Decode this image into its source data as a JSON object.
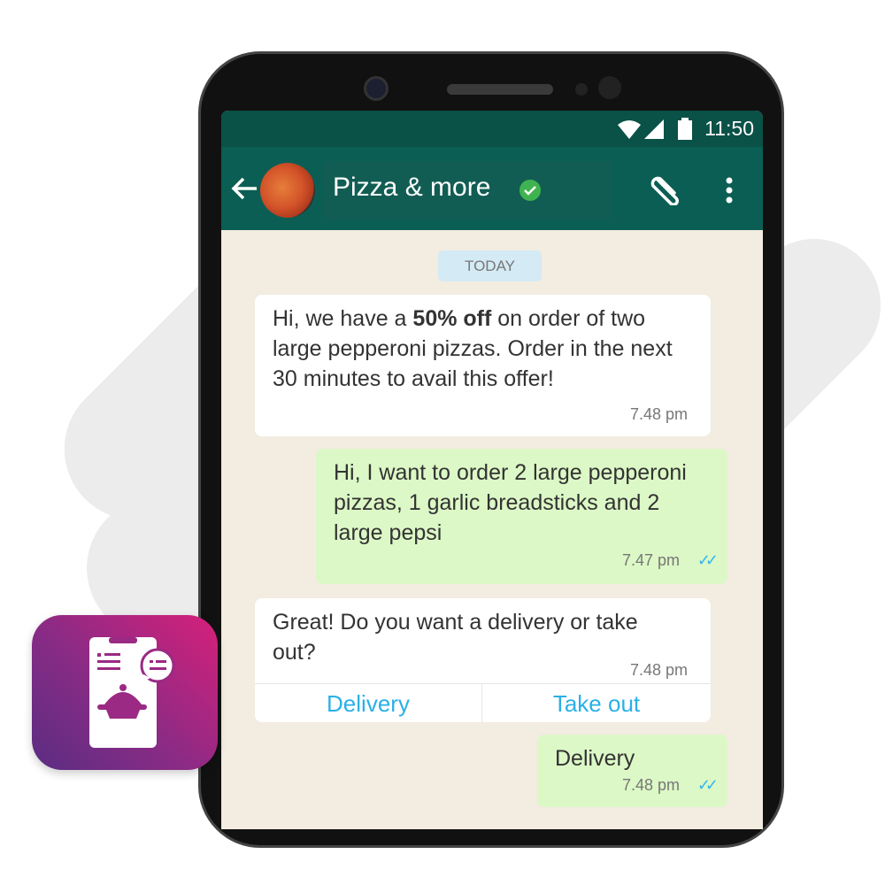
{
  "status_bar": {
    "time": "11:50"
  },
  "header": {
    "contact_name": "Pizza & more",
    "verified": true
  },
  "chat": {
    "date_label": "TODAY",
    "messages": [
      {
        "direction": "incoming",
        "text_before": "Hi, we have a ",
        "text_bold": "50% off",
        "text_after": " on order of two large pepperoni pizzas. Order in the next 30 minutes to avail this offer!",
        "time": "7.48 pm"
      },
      {
        "direction": "outgoing",
        "text": "Hi, I want to order 2 large pepperoni pizzas, 1 garlic breadsticks and 2 large pepsi",
        "time": "7.47 pm",
        "read": true
      },
      {
        "direction": "incoming",
        "text": "Great! Do you want a delivery or take out?",
        "time": "7.48 pm",
        "buttons": [
          "Delivery",
          "Take out"
        ]
      },
      {
        "direction": "outgoing",
        "text": "Delivery",
        "time": "7.48 pm",
        "read": true
      }
    ]
  },
  "colors": {
    "header": "#0b5e54",
    "status": "#0a5147",
    "outgoing": "#dcf8c6",
    "button_text": "#2ab0e8",
    "badge_start": "#d6207a",
    "badge_end": "#5a2d82"
  }
}
